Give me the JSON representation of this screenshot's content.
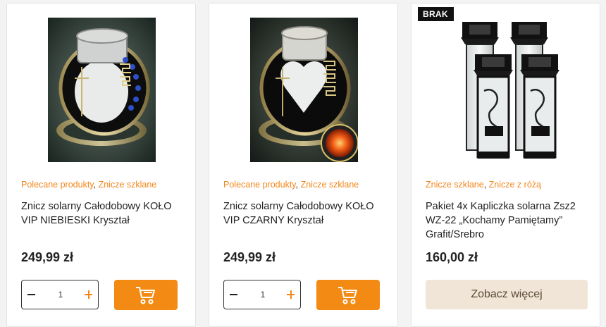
{
  "products": [
    {
      "categories": [
        "Polecane produkty",
        "Znicze szklane"
      ],
      "title": "Znicz solarny Całodobowy KOŁO VIP NIEBIESKI Kryształ",
      "price": "249,99 zł",
      "quantity": "1",
      "accent_color": "#2f4fc8"
    },
    {
      "categories": [
        "Polecane produkty",
        "Znicze szklane"
      ],
      "title": "Znicz solarny Całodobowy KOŁO VIP CZARNY Kryształ",
      "price": "249,99 zł",
      "quantity": "1",
      "accent_color": "#111111"
    },
    {
      "badge": "BRAK",
      "categories": [
        "Znicze szklane",
        "Znicze z różą"
      ],
      "title": "Pakiet 4x Kapliczka solarna Zsz2 WZ-22 „Kochamy Pamiętamy” Grafit/Srebro",
      "price": "160,00 zł",
      "more_label": "Zobacz więcej"
    }
  ],
  "category_separator": ", ",
  "colors": {
    "brand_orange": "#f28a14",
    "category_link": "#f2861a",
    "out_of_stock_badge": "#111111",
    "more_button_bg": "#f0e5d6"
  },
  "icons": {
    "cart": "shopping-cart-icon",
    "minus": "minus-icon",
    "plus": "plus-icon"
  }
}
